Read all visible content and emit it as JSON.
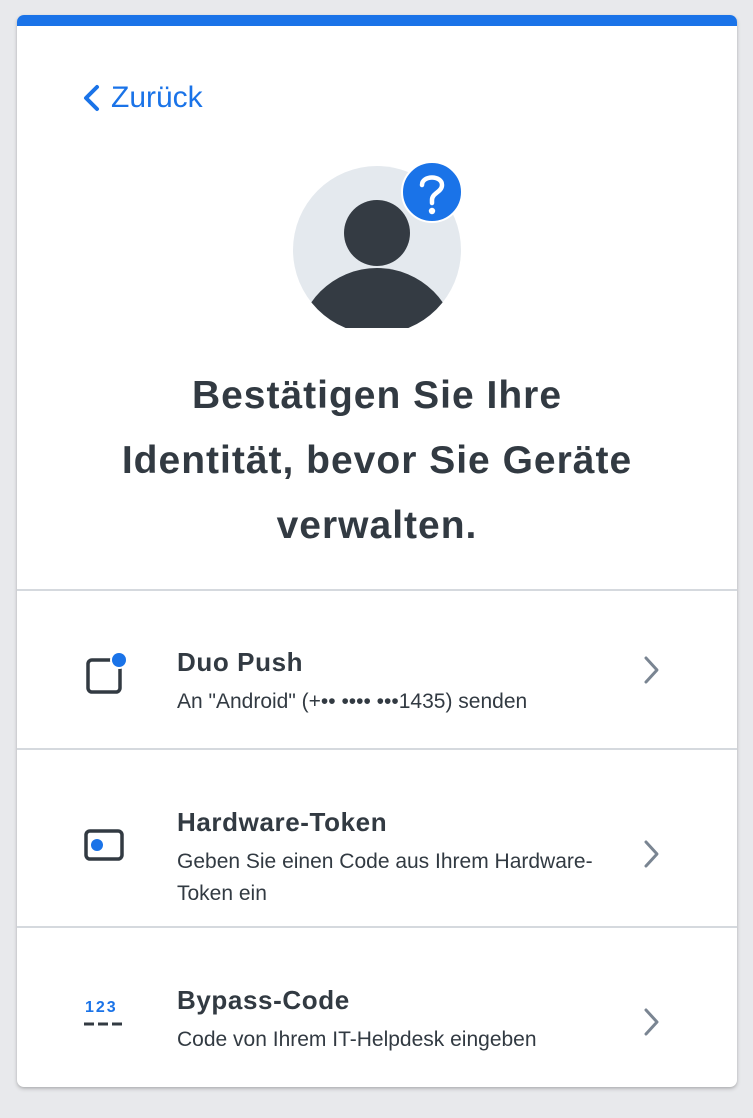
{
  "back": {
    "label": "Zurück"
  },
  "headline": {
    "line1": "Bestätigen Sie Ihre",
    "line2": "Identität, bevor Sie Geräte",
    "line3": "verwalten."
  },
  "options": [
    {
      "title": "Duo Push",
      "description": "An \"Android\" (+•• •••• •••1435) senden",
      "icon": "phone-push-icon"
    },
    {
      "title": "Hardware-Token",
      "description": "Geben Sie einen Code aus Ihrem Hardware-Token ein",
      "icon": "hardware-token-icon"
    },
    {
      "title": "Bypass-Code",
      "description": "Code von Ihrem IT-Helpdesk eingeben",
      "icon": "bypass-code-icon",
      "icon_text": "123"
    }
  ],
  "colors": {
    "accent": "#1a73e8",
    "text": "#323a42",
    "divider": "#d5d9de",
    "chevron": "#7a8592",
    "avatar_bg": "#e4e9ee"
  }
}
